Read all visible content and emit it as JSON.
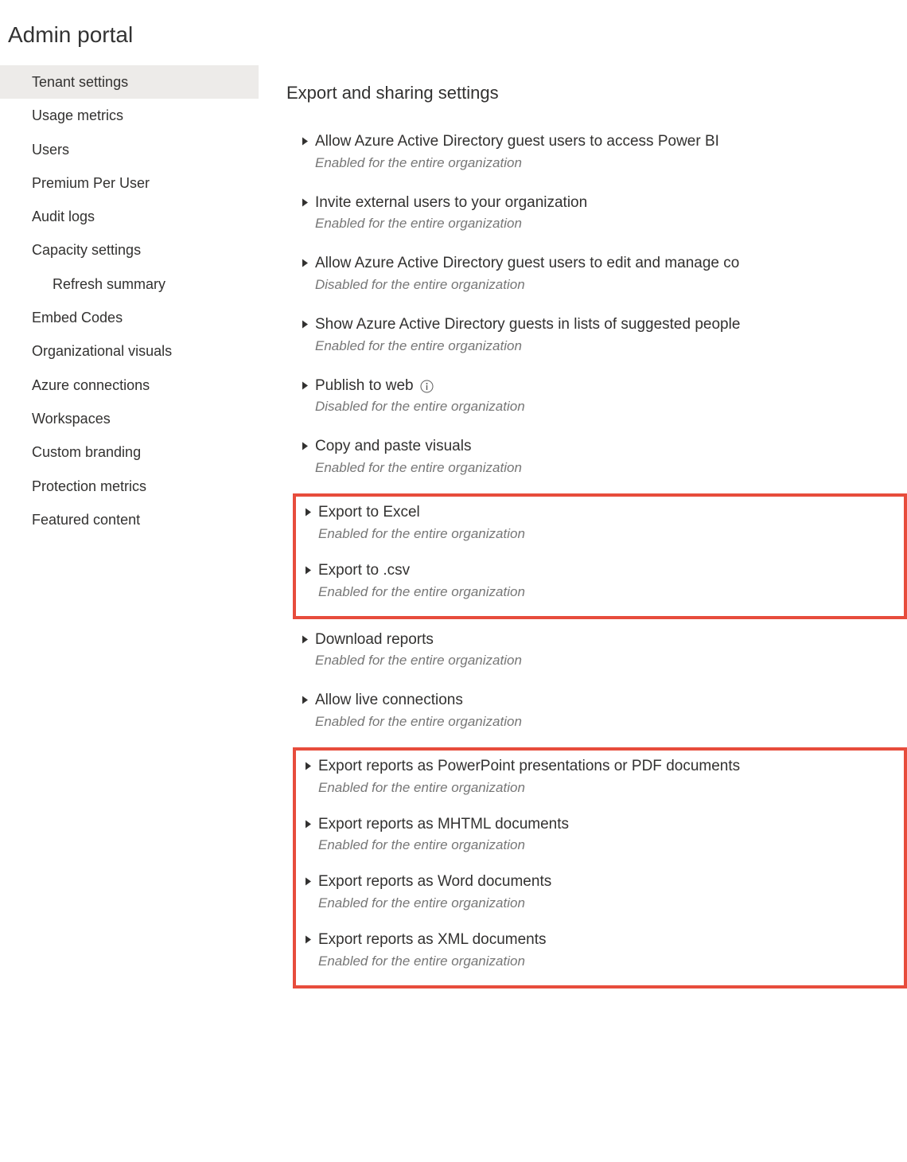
{
  "page_title": "Admin portal",
  "sidebar": {
    "items": [
      {
        "label": "Tenant settings",
        "active": true
      },
      {
        "label": "Usage metrics"
      },
      {
        "label": "Users"
      },
      {
        "label": "Premium Per User"
      },
      {
        "label": "Audit logs"
      },
      {
        "label": "Capacity settings"
      },
      {
        "label": "Refresh summary",
        "sub": true
      },
      {
        "label": "Embed Codes"
      },
      {
        "label": "Organizational visuals"
      },
      {
        "label": "Azure connections"
      },
      {
        "label": "Workspaces"
      },
      {
        "label": "Custom branding"
      },
      {
        "label": "Protection metrics"
      },
      {
        "label": "Featured content"
      }
    ]
  },
  "main": {
    "section_heading": "Export and sharing settings",
    "status_enabled": "Enabled for the entire organization",
    "status_disabled": "Disabled for the entire organization",
    "settings": [
      {
        "title": "Allow Azure Active Directory guest users to access Power BI",
        "status": "enabled",
        "info": false,
        "group": 0
      },
      {
        "title": "Invite external users to your organization",
        "status": "enabled",
        "info": false,
        "group": 0
      },
      {
        "title": "Allow Azure Active Directory guest users to edit and manage co",
        "status": "disabled",
        "info": false,
        "group": 0
      },
      {
        "title": "Show Azure Active Directory guests in lists of suggested people",
        "status": "enabled",
        "info": false,
        "group": 0
      },
      {
        "title": "Publish to web",
        "status": "disabled",
        "info": true,
        "group": 0
      },
      {
        "title": "Copy and paste visuals",
        "status": "enabled",
        "info": false,
        "group": 0
      },
      {
        "title": "Export to Excel",
        "status": "enabled",
        "info": false,
        "group": 1
      },
      {
        "title": "Export to .csv",
        "status": "enabled",
        "info": false,
        "group": 1
      },
      {
        "title": "Download reports",
        "status": "enabled",
        "info": false,
        "group": 0
      },
      {
        "title": "Allow live connections",
        "status": "enabled",
        "info": false,
        "group": 0
      },
      {
        "title": "Export reports as PowerPoint presentations or PDF documents",
        "status": "enabled",
        "info": false,
        "group": 2
      },
      {
        "title": "Export reports as MHTML documents",
        "status": "enabled",
        "info": false,
        "group": 2
      },
      {
        "title": "Export reports as Word documents",
        "status": "enabled",
        "info": false,
        "group": 2
      },
      {
        "title": "Export reports as XML documents",
        "status": "enabled",
        "info": false,
        "group": 2
      }
    ]
  },
  "highlight_color": "#e74c3c"
}
